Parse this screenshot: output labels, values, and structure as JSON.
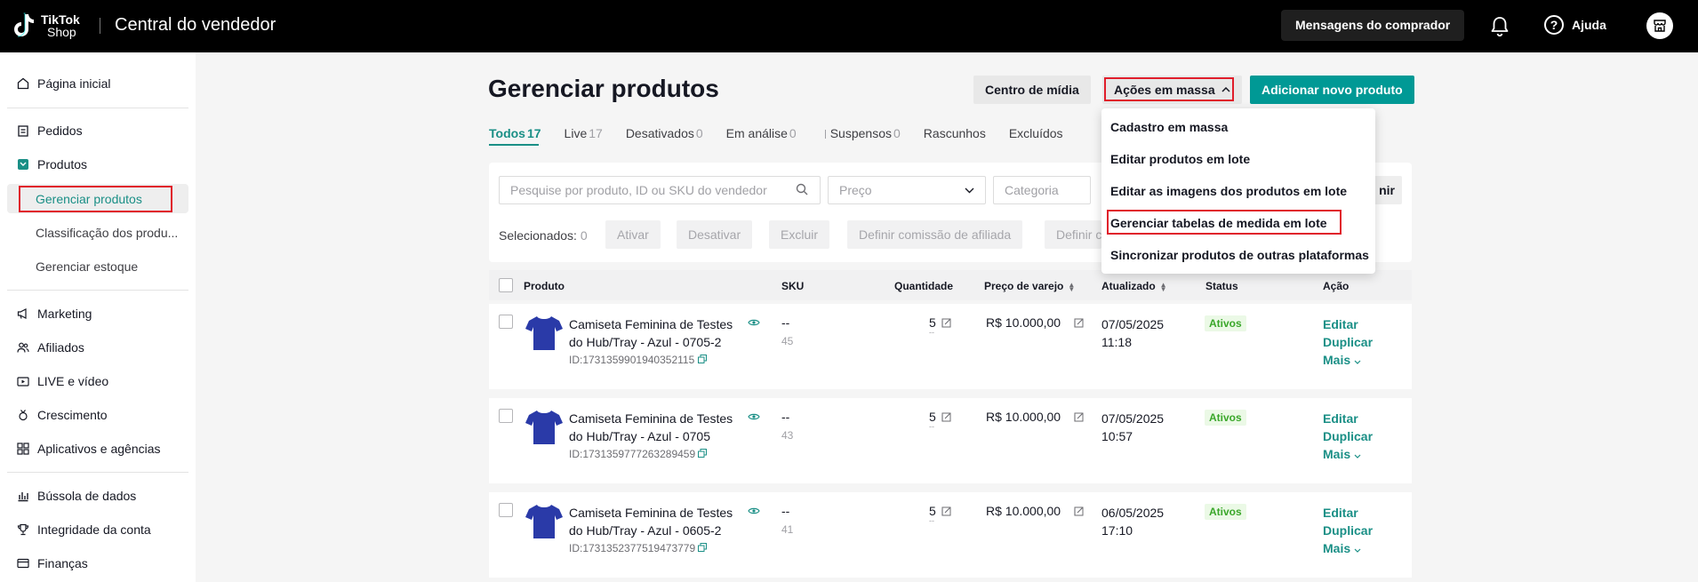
{
  "topbar": {
    "logo_line1": "TikTok",
    "logo_line2": "Shop",
    "app_title": "Central do vendedor",
    "buyer_messages": "Mensagens do comprador",
    "help": "Ajuda"
  },
  "sidebar": {
    "home": "Página inicial",
    "orders": "Pedidos",
    "products": "Produtos",
    "manage_products": "Gerenciar produtos",
    "product_rating": "Classificação dos produ...",
    "manage_stock": "Gerenciar estoque",
    "marketing": "Marketing",
    "affiliates": "Afiliados",
    "live_video": "LIVE e vídeo",
    "growth": "Crescimento",
    "apps_agencies": "Aplicativos e agências",
    "data_compass": "Bússola de dados",
    "account_integrity": "Integridade da conta",
    "finance": "Finanças"
  },
  "main": {
    "title": "Gerenciar produtos",
    "media_center": "Centro de mídia",
    "bulk_actions": "Ações em massa",
    "add_product": "Adicionar novo produto",
    "tabs": [
      {
        "label": "Todos",
        "count": "17"
      },
      {
        "label": "Live",
        "count": "17"
      },
      {
        "label": "Desativados",
        "count": "0"
      },
      {
        "label": "Em análise",
        "count": "0"
      },
      {
        "label": "Suspensos",
        "count": "0"
      },
      {
        "label": "Rascunhos",
        "count": ""
      },
      {
        "label": "Excluídos",
        "count": ""
      }
    ],
    "search_placeholder": "Pesquise por produto, ID ou SKU do vendedor",
    "price_placeholder": "Preço",
    "category_placeholder": "Categoria",
    "apply_partial": "nir",
    "selected_label": "Selecionados:",
    "selected_count": "0",
    "bulk_buttons": [
      "Ativar",
      "Desativar",
      "Excluir",
      "Definir comissão de afiliada",
      "Definir c"
    ]
  },
  "dropdown": {
    "items": [
      "Cadastro em massa",
      "Editar produtos em lote",
      "Editar as imagens dos produtos em lote",
      "Gerenciar tabelas de medida em lote",
      "Sincronizar produtos de outras plataformas"
    ]
  },
  "table": {
    "headers": {
      "product": "Produto",
      "sku": "SKU",
      "quantity": "Quantidade",
      "price": "Preço de varejo",
      "updated": "Atualizado",
      "status": "Status",
      "action": "Ação"
    },
    "rows": [
      {
        "name": "Camiseta Feminina de Testes do Hub/Tray - Azul - 0705-2",
        "id": "ID:1731359901940352115",
        "sku": "--",
        "sku_count": "45",
        "qty": "5",
        "qty_sub": "--",
        "price": "R$ 10.000,00",
        "updated_date": "07/05/2025",
        "updated_time": "11:18",
        "status": "Ativos",
        "edit": "Editar",
        "duplicate": "Duplicar",
        "more": "Mais"
      },
      {
        "name": "Camiseta Feminina de Testes do Hub/Tray - Azul - 0705",
        "id": "ID:1731359777263289459",
        "sku": "--",
        "sku_count": "43",
        "qty": "5",
        "qty_sub": "--",
        "price": "R$ 10.000,00",
        "updated_date": "07/05/2025",
        "updated_time": "10:57",
        "status": "Ativos",
        "edit": "Editar",
        "duplicate": "Duplicar",
        "more": "Mais"
      },
      {
        "name": "Camiseta Feminina de Testes do Hub/Tray - Azul - 0605-2",
        "id": "ID:1731352377519473779",
        "sku": "--",
        "sku_count": "41",
        "qty": "5",
        "qty_sub": "--",
        "price": "R$ 10.000,00",
        "updated_date": "06/05/2025",
        "updated_time": "17:10",
        "status": "Ativos",
        "edit": "Editar",
        "duplicate": "Duplicar",
        "more": "Mais"
      }
    ]
  },
  "colors": {
    "accent": "#1a8f86",
    "primary_button": "#009995",
    "highlight_border": "#e01e2b",
    "status_green": "#3aa72a",
    "topbar": "#000000"
  },
  "icons": {
    "home": "home-icon",
    "orders": "clipboard-icon",
    "products": "product-box-icon",
    "marketing": "megaphone-icon",
    "affiliates": "people-icon",
    "live": "video-icon",
    "growth": "medal-icon",
    "apps": "grid-icon",
    "data": "bar-chart-icon",
    "integrity": "trophy-icon",
    "finance": "card-icon"
  }
}
